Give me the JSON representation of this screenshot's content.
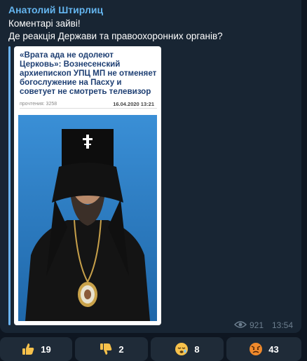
{
  "message": {
    "sender": "Анатолий Штирлиц",
    "line1": "Коментарі зайві!",
    "line2": "Де реакція Держави та правоохоронних органів?"
  },
  "article": {
    "headline": "«Врата ада не одолеют Церковь»: Вознесенский архиепископ УПЦ МП не отменяет богослужение на Пасху и советует не смотреть телевизор",
    "views_label": "прочтения: 3258",
    "date": "16.04.2020 13:21"
  },
  "footer": {
    "views": "921",
    "time": "13:54",
    "views_icon": "eye-icon"
  },
  "reactions": [
    {
      "icon": "thumbs-up-icon",
      "count": "19"
    },
    {
      "icon": "thumbs-down-icon",
      "count": "2"
    },
    {
      "icon": "sleepy-face-icon",
      "count": "8"
    },
    {
      "icon": "angry-face-icon",
      "count": "43"
    }
  ],
  "colors": {
    "background": "#0e1621",
    "bubble": "#182533",
    "sender": "#64b5ef",
    "quote_bar": "#6ab3f3",
    "headline": "#1e3f73",
    "reaction_bg": "#1f2b38"
  }
}
